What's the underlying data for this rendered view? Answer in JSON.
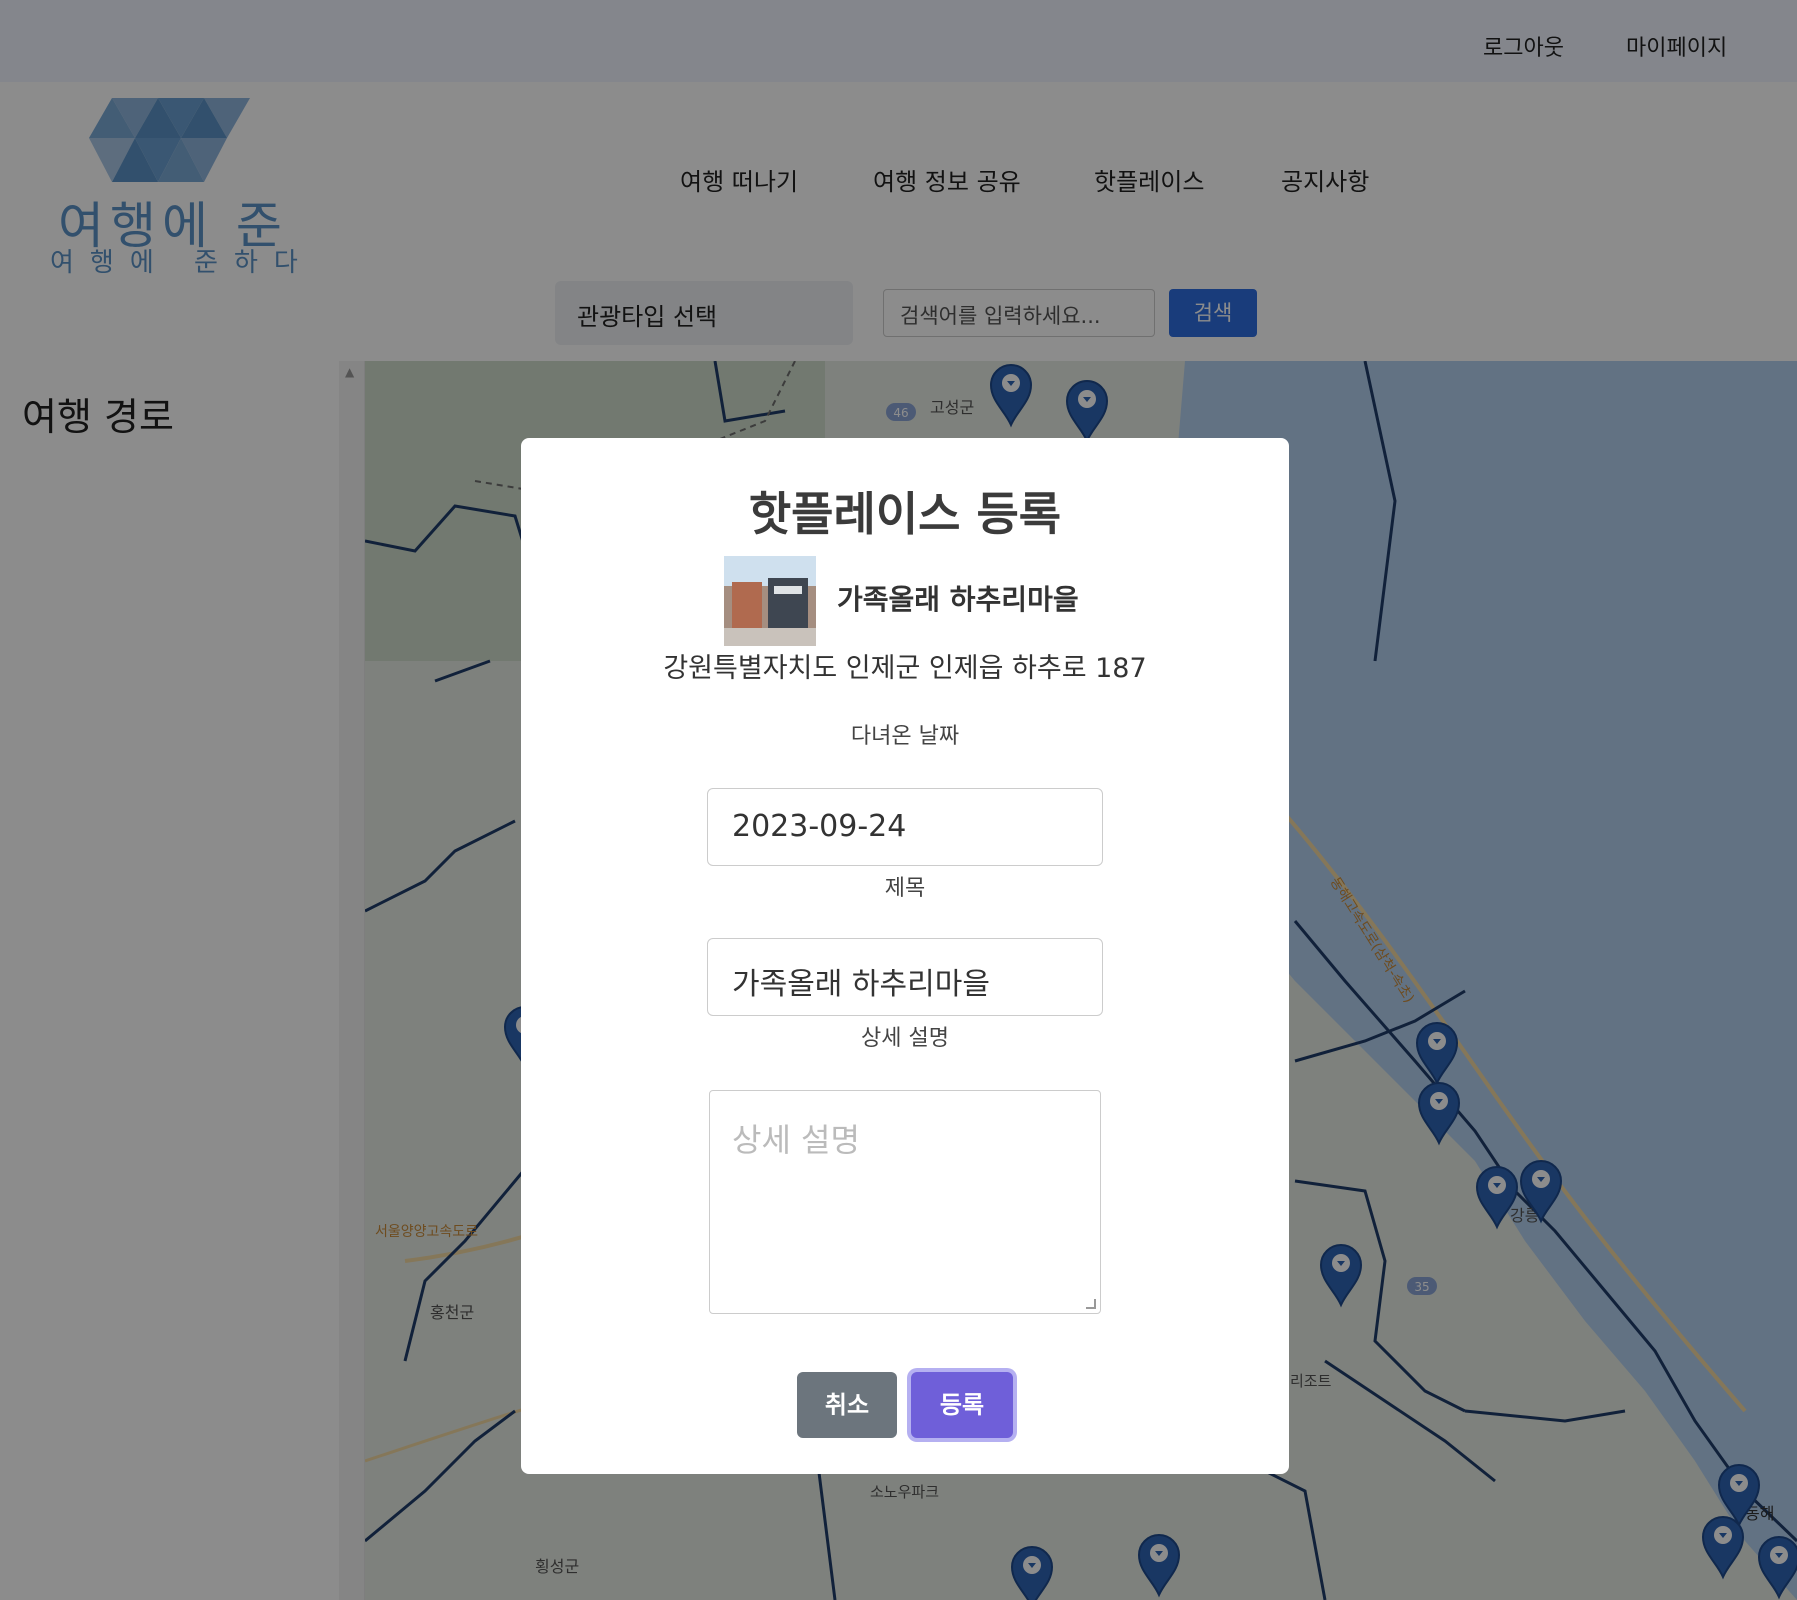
{
  "topbar": {
    "logout": "로그아웃",
    "mypage": "마이페이지"
  },
  "logo": {
    "main": "여행에 준",
    "sub": "여행에 준하다"
  },
  "nav": {
    "items": [
      "여행 떠나기",
      "여행 정보 공유",
      "핫플레이스",
      "공지사항"
    ]
  },
  "search": {
    "type_select": "관광타입 선택",
    "placeholder": "검색어를 입력하세요...",
    "button": "검색"
  },
  "sidebar": {
    "title": "여행 경로"
  },
  "map": {
    "labels": [
      "고성군",
      "홍천군",
      "횡성군",
      "강릉",
      "동해",
      "서울양양고속도로",
      "동해고속도로(삼척-속초)",
      "소노우파크",
      "리조트"
    ],
    "route_numbers": [
      "46",
      "35"
    ]
  },
  "modal": {
    "title": "핫플레이스 등록",
    "place_name": "가족올래 하추리마을",
    "place_address": "강원특별자치도 인제군 인제읍 하추로 187",
    "date_label": "다녀온 날짜",
    "date_value": "2023-09-24",
    "title_label": "제목",
    "title_value": "가족올래 하추리마을",
    "desc_label": "상세 설명",
    "desc_placeholder": "상세 설명",
    "cancel": "취소",
    "submit": "등록"
  },
  "colors": {
    "accent": "#2f6ee0",
    "submit": "#6f5fd9",
    "cancel": "#6c757d",
    "logo": "#5b93c6",
    "pin": "#2e65b5",
    "sea": "#b3d0ef"
  }
}
